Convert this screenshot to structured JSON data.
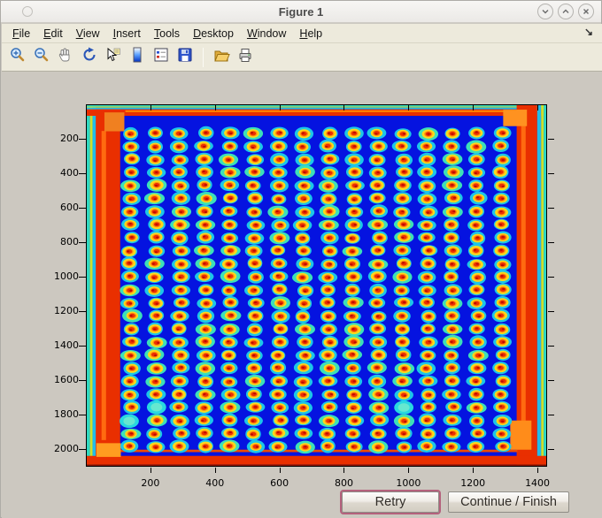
{
  "window": {
    "title": "Figure 1",
    "controls": [
      {
        "name": "shade-window",
        "glyph": "chevron-down"
      },
      {
        "name": "maximize-window",
        "glyph": "chevron-up"
      },
      {
        "name": "close-window",
        "glyph": "cross"
      }
    ]
  },
  "menu": {
    "items": [
      "File",
      "Edit",
      "View",
      "Insert",
      "Tools",
      "Desktop",
      "Window",
      "Help"
    ],
    "dock_arrow": "↘"
  },
  "toolbar": {
    "tools": [
      "zoom-in",
      "zoom-out",
      "pan",
      "rotate-3d",
      "data-cursor",
      "insert-colorbar",
      "insert-legend",
      "save-figure",
      "separator",
      "open-file",
      "print-figure"
    ]
  },
  "actions": {
    "retry_label": "Retry",
    "continue_label": "Continue / Finish"
  },
  "chart_data": {
    "type": "heatmap",
    "title": "",
    "xlabel": "",
    "ylabel": "",
    "colormap": "jet",
    "description": "Jet-colormap image of a scanned microarray/microplate: a 16 x 25 grid of hot spots (red cores, yellow-orange rings, cyan halos) on a saturated blue field, with red saturated bands along all four plate edges and cyan/yellow fringe at the extreme borders.",
    "x_range": [
      0,
      1430
    ],
    "y_range": [
      0,
      2100
    ],
    "x_ticks": [
      200,
      400,
      600,
      800,
      1000,
      1200,
      1400
    ],
    "y_ticks": [
      200,
      400,
      600,
      800,
      1000,
      1200,
      1400,
      1600,
      1800,
      2000
    ],
    "grid": {
      "cols": 16,
      "rows": 25,
      "x0": 137,
      "y0": 164,
      "dx": 77,
      "dy": 76
    },
    "colors": {
      "background": "#0513e0",
      "halo": "#1cc6e8",
      "halo_alt": "#3ce0b8",
      "ring_yellow": "#ffd91a",
      "ring_orange": "#ff9010",
      "core": "#ec2f00",
      "core_spot": "#bc0d00",
      "edge_red": "#e92f00"
    },
    "cyan_spots": [
      [
        0,
        22
      ],
      [
        1,
        21
      ],
      [
        11,
        21
      ]
    ],
    "regions": [
      [
        0,
        0,
        10,
        2100,
        "#2fd8c0"
      ],
      [
        10,
        0,
        8,
        2100,
        "#cfe02a"
      ],
      [
        18,
        0,
        14,
        2100,
        "#23bce8"
      ],
      [
        28,
        0,
        76,
        2100,
        "#e92f00"
      ],
      [
        46,
        150,
        14,
        1800,
        "#ff6b10"
      ],
      [
        0,
        0,
        1430,
        8,
        "#2fd8c0"
      ],
      [
        0,
        8,
        1430,
        6,
        "#cfe02a"
      ],
      [
        0,
        14,
        1430,
        10,
        "#23bce8"
      ],
      [
        0,
        24,
        1430,
        38,
        "#e92f00"
      ],
      [
        120,
        30,
        1180,
        10,
        "#ff8a00"
      ],
      [
        1338,
        0,
        64,
        2100,
        "#e92f00"
      ],
      [
        1402,
        0,
        12,
        2100,
        "#23bce8"
      ],
      [
        1414,
        0,
        8,
        2100,
        "#cfe02a"
      ],
      [
        1422,
        0,
        8,
        2100,
        "#2fd8c0"
      ],
      [
        1352,
        120,
        14,
        1760,
        "#ff6b10"
      ],
      [
        0,
        2042,
        1430,
        50,
        "#e92f00"
      ],
      [
        0,
        2092,
        1430,
        8,
        "#8a1400"
      ],
      [
        90,
        2006,
        1250,
        14,
        "#ef4a00"
      ],
      [
        55,
        42,
        62,
        110,
        "#f08020"
      ],
      [
        1296,
        26,
        74,
        96,
        "#ff9220"
      ],
      [
        1318,
        1836,
        66,
        170,
        "#ff8c1a"
      ],
      [
        30,
        1968,
        76,
        80,
        "#ff9c20"
      ]
    ]
  }
}
